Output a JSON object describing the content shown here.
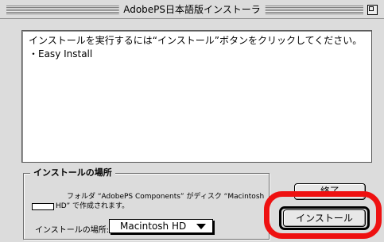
{
  "window": {
    "title": "AdobePS日本語版インストーラ"
  },
  "message": {
    "lines": [
      "インストールを実行するには“インストール”ボタンをクリックしてください。",
      "・Easy Install"
    ]
  },
  "install_location": {
    "group_title": "インストールの場所",
    "description_line1": "フォルダ “AdobePS Components” がディスク “Macintosh",
    "description_line2": "HD” で作成されます。",
    "location_label": "インストールの場所:",
    "selected_disk": "Macintosh HD"
  },
  "buttons": {
    "quit_label": "終了",
    "install_label": "インストール"
  },
  "annotation": {
    "highlight_color": "#ee1111",
    "highlight_target": "install-button"
  },
  "icons": {
    "zoom": "zoom-box-icon",
    "disk": "folder-icon",
    "dropdown": "triangle-down-icon"
  }
}
